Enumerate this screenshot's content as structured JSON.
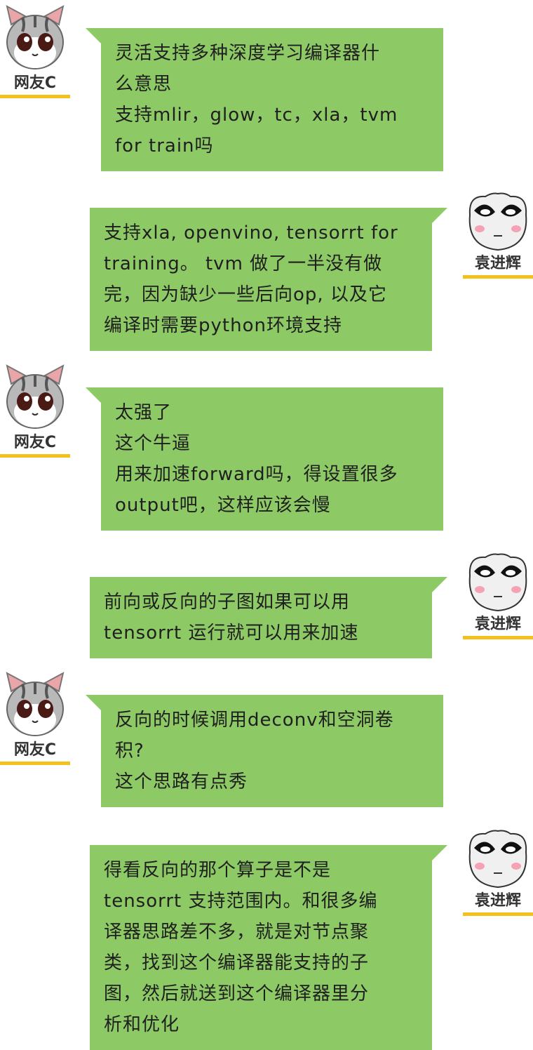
{
  "theme": {
    "bubble_color": "#8dc965",
    "underline_color": "#f4c01c"
  },
  "users": {
    "left": {
      "name": "网友C",
      "avatar_icon": "cat-avatar-icon"
    },
    "right": {
      "name": "袁进辉",
      "avatar_icon": "panda-avatar-icon"
    }
  },
  "messages": [
    {
      "side": "left",
      "lines": [
        "灵活支持多种深度学习编译器什",
        "么意思",
        "支持mlir，glow，tc，xla，tvm",
        "for train吗"
      ]
    },
    {
      "side": "right",
      "lines": [
        "支持xla, openvino, tensorrt for",
        "training。 tvm 做了一半没有做",
        "完，因为缺少一些后向op, 以及它",
        "编译时需要python环境支持"
      ]
    },
    {
      "side": "left",
      "lines": [
        "太强了",
        "这个牛逼",
        "用来加速forward吗，得设置很多",
        "output吧，这样应该会慢"
      ]
    },
    {
      "side": "right",
      "lines": [
        "前向或反向的子图如果可以用",
        "tensorrt 运行就可以用来加速"
      ]
    },
    {
      "side": "left",
      "lines": [
        "反向的时候调用deconv和空洞卷",
        "积?",
        "这个思路有点秀"
      ]
    },
    {
      "side": "right",
      "lines": [
        "得看反向的那个算子是不是",
        "tensorrt 支持范围内。和很多编",
        "译器思路差不多，就是对节点聚",
        "类，找到这个编译器能支持的子",
        "图，然后就送到这个编译器里分",
        "析和优化"
      ]
    }
  ]
}
